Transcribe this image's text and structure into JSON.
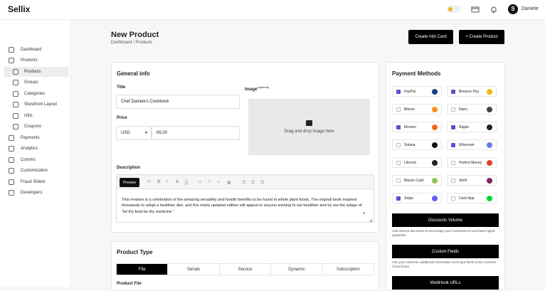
{
  "app": {
    "logo": "Sellix",
    "username": "Daniele",
    "avatar_letter": "S"
  },
  "sidebar": {
    "items": [
      {
        "label": "Dashboard",
        "icon": "dashboard-icon"
      },
      {
        "label": "Products",
        "icon": "box-icon"
      },
      {
        "label": "Products",
        "icon": "sitemap-icon",
        "active": true,
        "sub": true
      },
      {
        "label": "Groups",
        "icon": "layers-icon",
        "sub": true
      },
      {
        "label": "Categories",
        "icon": "category-icon",
        "sub": true
      },
      {
        "label": "Storefront Layout",
        "icon": "layout-icon",
        "sub": true
      },
      {
        "label": "Utils",
        "icon": "tools-icon",
        "sub": true
      },
      {
        "label": "Coupons",
        "icon": "tag-icon",
        "sub": true
      },
      {
        "label": "Payments",
        "icon": "wallet-icon"
      },
      {
        "label": "Analytics",
        "icon": "analytics-icon"
      },
      {
        "label": "Comms",
        "icon": "chat-icon"
      },
      {
        "label": "Customization",
        "icon": "brush-icon"
      },
      {
        "label": "Fraud Shield",
        "icon": "shield-icon"
      },
      {
        "label": "Developers",
        "icon": "code-icon"
      }
    ]
  },
  "page": {
    "title": "New Product",
    "breadcrumb": "Dashboard  /  Products"
  },
  "actions": {
    "info_card": "Create Info Card",
    "create_product": "+ Create Product"
  },
  "general": {
    "heading": "General info",
    "title_label": "Title",
    "title_value": "Chef Daniele's Cookbook",
    "image_label": "Image",
    "image_optional": "(optional)",
    "dropzone_text": "Drag and drop image here",
    "price_label": "Price",
    "currency": "USD",
    "price_value": "65,00",
    "description_label": "Description",
    "preview_label": "Preview",
    "description_text": "This revision is a celebration of the amazing versatility and health benefits to be found in whole plant foods. The original book inspired thousands to adopt a healthier diet, and this newly updated edition will appeal to anyone wishing to eat healthier and try out the adage of \"let thy food be thy medicine.\""
  },
  "product_type": {
    "heading": "Product Type",
    "tabs": [
      "File",
      "Serials",
      "Service",
      "Dynamic",
      "Subscription"
    ],
    "active_tab": "File",
    "next_label": "Product File"
  },
  "payments": {
    "heading": "Payment Methods",
    "methods": [
      {
        "name": "PayPal",
        "checked": true,
        "color": "#1f3c88"
      },
      {
        "name": "Binance Pay",
        "checked": true,
        "color": "#f0b90b"
      },
      {
        "name": "Bitcoin",
        "checked": false,
        "color": "#f7931a"
      },
      {
        "name": "Nano",
        "checked": false,
        "color": "#444444"
      },
      {
        "name": "Monero",
        "checked": true,
        "color": "#f26822"
      },
      {
        "name": "Ripple",
        "checked": true,
        "color": "#222222"
      },
      {
        "name": "Solana",
        "checked": false,
        "color": "#111111"
      },
      {
        "name": "Ethereum",
        "checked": true,
        "color": "#627eea"
      },
      {
        "name": "Litecoin",
        "checked": false,
        "color": "#222222"
      },
      {
        "name": "Perfect Money",
        "checked": false,
        "color": "#e0412b"
      },
      {
        "name": "Bitcoin Cash",
        "checked": false,
        "color": "#8dc351"
      },
      {
        "name": "Skrill",
        "checked": false,
        "color": "#862165"
      },
      {
        "name": "Stripe",
        "checked": true,
        "color": "#635bff"
      },
      {
        "name": "Cash App",
        "checked": false,
        "color": "#00d632"
      }
    ],
    "discounts_button": "Discounts Volume",
    "discounts_note": "Add volume discounts to encourage your customers to purchase higher quantities",
    "custom_fields_button": "Custom Fields",
    "custom_fields_note": "Ask your customer additional information and input fields at the moment of purchase",
    "webhook_button": "WebHook URLs"
  },
  "colors": {
    "accent": "#000000",
    "checkbox": "#5a4fcf",
    "toggle": "#f0b429"
  }
}
